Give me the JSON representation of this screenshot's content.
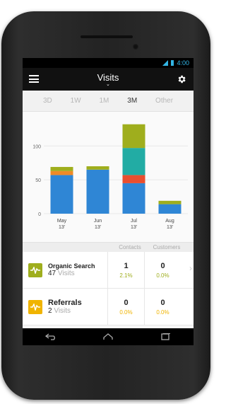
{
  "status_bar": {
    "time": "4:00"
  },
  "app_bar": {
    "title": "Visits"
  },
  "tabs": [
    {
      "label": "3D",
      "active": false
    },
    {
      "label": "1W",
      "active": false
    },
    {
      "label": "1M",
      "active": false
    },
    {
      "label": "3M",
      "active": true
    },
    {
      "label": "Other",
      "active": false
    }
  ],
  "chart_data": {
    "type": "bar",
    "stacked": true,
    "categories": [
      [
        "May",
        "13'"
      ],
      [
        "Jun",
        "13'"
      ],
      [
        "Jul",
        "13'"
      ],
      [
        "Aug",
        "13'"
      ]
    ],
    "yticks": [
      0,
      50,
      100
    ],
    "ylim": [
      0,
      140
    ],
    "series": [
      {
        "color": "#2f86d5",
        "values": [
          57,
          65,
          45,
          14
        ]
      },
      {
        "color": "#e94f2f",
        "values": [
          0,
          0,
          12,
          0
        ]
      },
      {
        "color": "#ef8a27",
        "values": [
          6,
          0,
          0,
          0
        ]
      },
      {
        "color": "#22aca4",
        "values": [
          0,
          0,
          40,
          0
        ]
      },
      {
        "color": "#9fae1d",
        "values": [
          6,
          5,
          35,
          5
        ]
      }
    ]
  },
  "columns": {
    "contacts": "Contacts",
    "customers": "Customers"
  },
  "rows": [
    {
      "name": "Organic Search",
      "visits": "47",
      "visits_label": "Visits",
      "badge_color": "#9fae1d",
      "contacts": "1",
      "contacts_pct": "2.1%",
      "customers": "0",
      "customers_pct": "0.0%",
      "pct_color": "#9fae1d"
    },
    {
      "name": "Referrals",
      "visits": "2",
      "visits_label": "Visits",
      "badge_color": "#f0b400",
      "contacts": "0",
      "contacts_pct": "0.0%",
      "customers": "0",
      "customers_pct": "0.0%",
      "pct_color": "#f0b400"
    }
  ]
}
